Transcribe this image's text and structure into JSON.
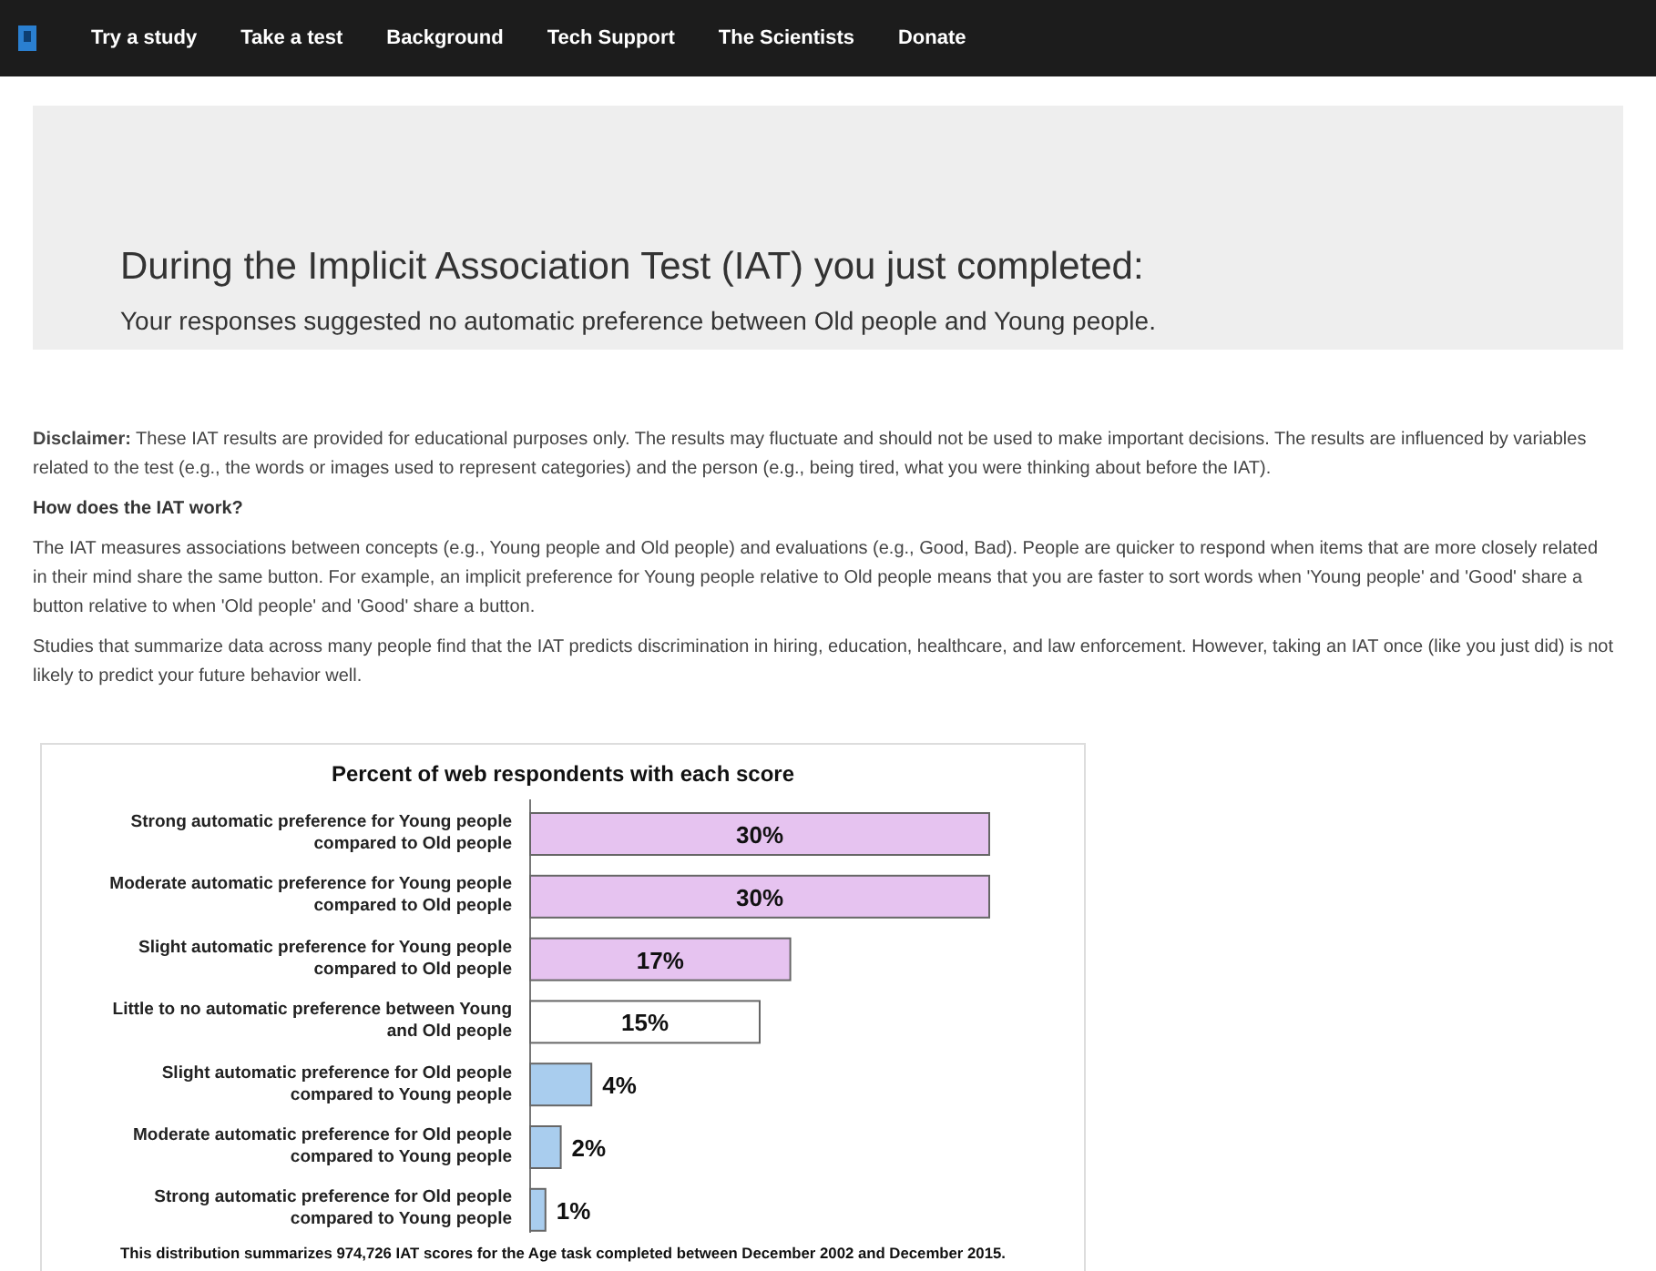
{
  "nav": {
    "items": [
      "Try a study",
      "Take a test",
      "Background",
      "Tech Support",
      "The Scientists",
      "Donate"
    ]
  },
  "result": {
    "title": "During the Implicit Association Test (IAT) you just completed:",
    "summary": "Your responses suggested no automatic preference between Old people and Young people."
  },
  "paragraphs": [
    {
      "kind": "text",
      "text": "**Disclaimer:** These IAT results are provided for educational purposes only. The results may fluctuate and should not be used to make important decisions. The results are influenced by variables related to the test (e.g., the words or images used to represent categories) and the person (e.g., being tired, what you were thinking about before the IAT)."
    },
    {
      "kind": "heading",
      "text": "How does the IAT work?"
    },
    {
      "kind": "text",
      "text": "The IAT measures associations between concepts (e.g., Young people and Old people) and evaluations (e.g., Good, Bad). People are quicker to respond when items that are more closely related in their mind share the same button. For example, an implicit preference for Young people relative to Old people means that you are faster to sort words when 'Young people' and 'Good' share a button relative to when 'Old people' and 'Good' share a button."
    },
    {
      "kind": "text",
      "text": "Studies that summarize data across many people find that the IAT predicts discrimination in hiring, education, healthcare, and law enforcement. However, taking an IAT once (like you just did) is not likely to predict your future behavior well."
    }
  ],
  "chart": {
    "chart_data": {
      "type": "bar",
      "orientation": "horizontal",
      "title": "Percent of web respondents with each score",
      "categories": [
        "Strong automatic preference for Young people compared to Old people",
        "Moderate automatic preference for Young people compared to Old people",
        "Slight automatic preference for Young people compared to Old people",
        "Little to no automatic preference between Young and Old people",
        "Slight automatic preference for Old people compared to Young people",
        "Moderate automatic preference for Old people compared to Young people",
        "Strong automatic preference for Old people compared to Young people"
      ],
      "values": [
        30,
        30,
        17,
        15,
        4,
        2,
        1
      ],
      "value_labels": [
        "30%",
        "30%",
        "17%",
        "15%",
        "4%",
        "2%",
        "1%"
      ]
    },
    "bars": [
      {
        "color": "#e6c3f0"
      },
      {
        "color": "#e6c3f0"
      },
      {
        "color": "#e6c3f0"
      },
      {
        "color": "#ffffff"
      },
      {
        "color": "#a9cdee"
      },
      {
        "color": "#a9cdee"
      },
      {
        "color": "#a9cdee"
      }
    ],
    "caption": "This distribution summarizes 974,726 IAT scores for the Age task completed between December 2002 and December 2015."
  }
}
